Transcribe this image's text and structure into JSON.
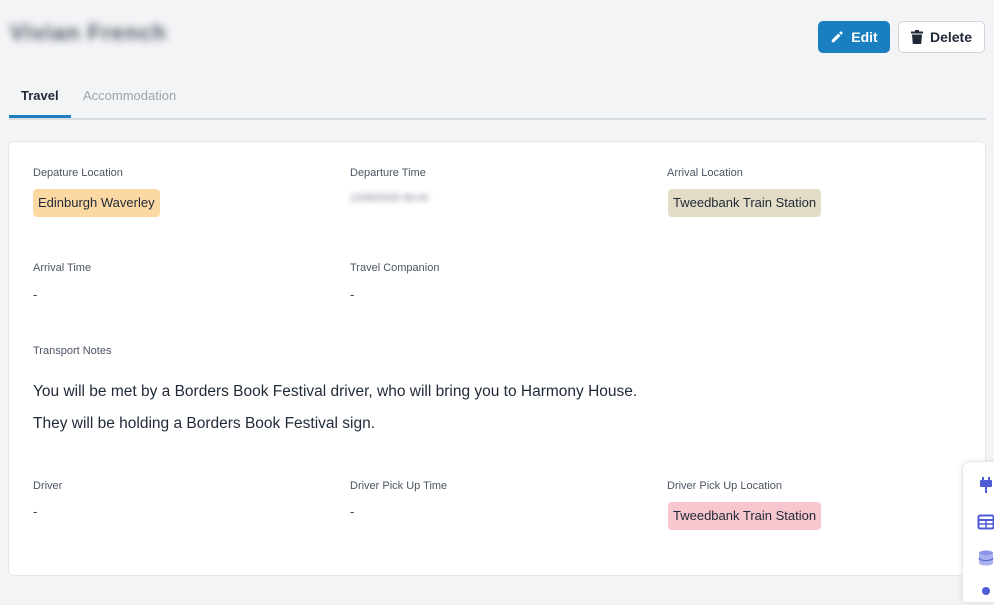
{
  "header": {
    "title": "Vivian French",
    "edit_label": "Edit",
    "delete_label": "Delete"
  },
  "tabs": [
    {
      "label": "Travel",
      "active": true
    },
    {
      "label": "Accommodation",
      "active": false
    }
  ],
  "travel": {
    "departure_location": {
      "label": "Depature Location",
      "value": "Edinburgh Waverley"
    },
    "departure_time": {
      "label": "Departure Time",
      "value": "12/06/2025 09:44"
    },
    "arrival_location": {
      "label": "Arrival Location",
      "value": "Tweedbank Train Station"
    },
    "arrival_time": {
      "label": "Arrival Time",
      "value": "-"
    },
    "travel_companion": {
      "label": "Travel Companion",
      "value": "-"
    },
    "transport_notes": {
      "label": "Transport Notes",
      "line1": "You will be met by a Borders Book Festival driver, who will bring you to Harmony House.",
      "line2": "They will be holding a Borders Book Festival sign."
    },
    "driver": {
      "label": "Driver",
      "value": "-"
    },
    "driver_pickup_time": {
      "label": "Driver Pick Up Time",
      "value": "-"
    },
    "driver_pickup_location": {
      "label": "Driver Pick Up Location",
      "value": "Tweedbank Train Station"
    }
  },
  "colors": {
    "accent": "#1a7fc1",
    "chip_orange": "#fcd9a3",
    "chip_tan": "#e3dcc6",
    "chip_pink": "#f8c6cf"
  },
  "floatbar_icons": [
    "plug-icon",
    "table-icon",
    "database-icon",
    "dot-icon"
  ]
}
